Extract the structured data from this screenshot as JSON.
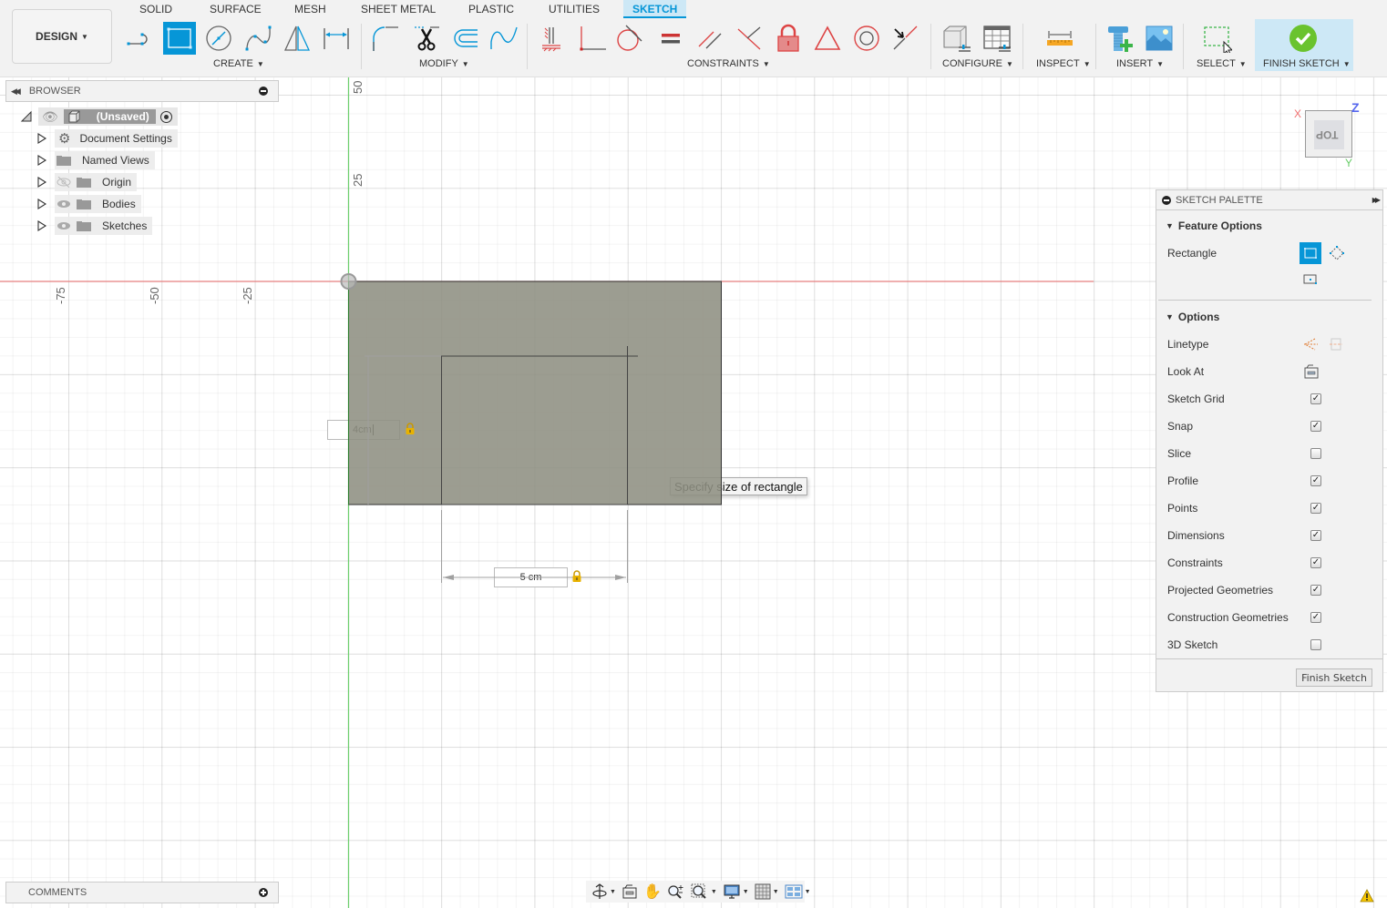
{
  "workspace": {
    "label": "DESIGN"
  },
  "tabs": [
    {
      "label": "SOLID",
      "active": false
    },
    {
      "label": "SURFACE",
      "active": false
    },
    {
      "label": "MESH",
      "active": false
    },
    {
      "label": "SHEET METAL",
      "active": false
    },
    {
      "label": "PLASTIC",
      "active": false
    },
    {
      "label": "UTILITIES",
      "active": false
    },
    {
      "label": "SKETCH",
      "active": true
    }
  ],
  "groups": {
    "create": {
      "label": "CREATE",
      "tools": [
        "line-icon",
        "rectangle-icon",
        "circle-icon",
        "spline-icon",
        "mirror-icon",
        "sketch-dimension-icon"
      ],
      "selected": "rectangle-icon"
    },
    "modify": {
      "label": "MODIFY",
      "tools": [
        "fillet-icon",
        "trim-icon",
        "offset-icon",
        "conic-curve-icon"
      ]
    },
    "constraints": {
      "label": "CONSTRAINTS",
      "tools": [
        "horizontal-vertical-icon",
        "coincident-icon",
        "tangent-icon",
        "equal-icon",
        "parallel-icon",
        "perpendicular-icon",
        "fix-icon",
        "midpoint-icon",
        "concentric-icon",
        "collinear-icon"
      ]
    },
    "configure": {
      "label": "CONFIGURE"
    },
    "inspect": {
      "label": "INSPECT"
    },
    "insert": {
      "label": "INSERT"
    },
    "select": {
      "label": "SELECT"
    },
    "finish": {
      "label": "FINISH SKETCH"
    }
  },
  "browser": {
    "title": "BROWSER",
    "root": {
      "label": "(Unsaved)"
    },
    "items": [
      {
        "label": "Document Settings",
        "icon": "gear-icon",
        "eye": "none"
      },
      {
        "label": "Named Views",
        "icon": "folder-icon",
        "eye": "none"
      },
      {
        "label": "Origin",
        "icon": "folder-icon",
        "eye": "hidden"
      },
      {
        "label": "Bodies",
        "icon": "folder-icon",
        "eye": "visible"
      },
      {
        "label": "Sketches",
        "icon": "folder-icon",
        "eye": "visible"
      }
    ]
  },
  "canvas": {
    "axis_labels_x": [
      "-75",
      "-50",
      "-25"
    ],
    "axis_labels_y": [
      "50",
      "25"
    ],
    "height_input": "4cm",
    "width_input": "5 cm",
    "tooltip": "Specify size of rectangle",
    "colors": {
      "x_axis": "#e88080",
      "y_axis": "#6ccf6c",
      "profile_fill": "#8e9082"
    }
  },
  "viewcube": {
    "face": "TOP",
    "x": "X",
    "y": "Y",
    "z": "Z"
  },
  "palette": {
    "title": "SKETCH PALETTE",
    "feature_options": {
      "label": "Feature Options",
      "rectangle_label": "Rectangle"
    },
    "options_label": "Options",
    "linetype_label": "Linetype",
    "lookat_label": "Look At",
    "checkboxes": [
      {
        "label": "Sketch Grid",
        "checked": true
      },
      {
        "label": "Snap",
        "checked": true
      },
      {
        "label": "Slice",
        "checked": false
      },
      {
        "label": "Profile",
        "checked": true
      },
      {
        "label": "Points",
        "checked": true
      },
      {
        "label": "Dimensions",
        "checked": true
      },
      {
        "label": "Constraints",
        "checked": true
      },
      {
        "label": "Projected Geometries",
        "checked": true
      },
      {
        "label": "Construction Geometries",
        "checked": true
      },
      {
        "label": "3D Sketch",
        "checked": false
      }
    ],
    "finish_button": "Finish Sketch"
  },
  "comments": {
    "title": "COMMENTS"
  },
  "navbar": {
    "tools": [
      "orbit-icon",
      "look-at-icon",
      "pan-icon",
      "zoom-icon",
      "fit-icon",
      "display-settings-icon",
      "grid-settings-icon",
      "viewports-icon"
    ]
  }
}
